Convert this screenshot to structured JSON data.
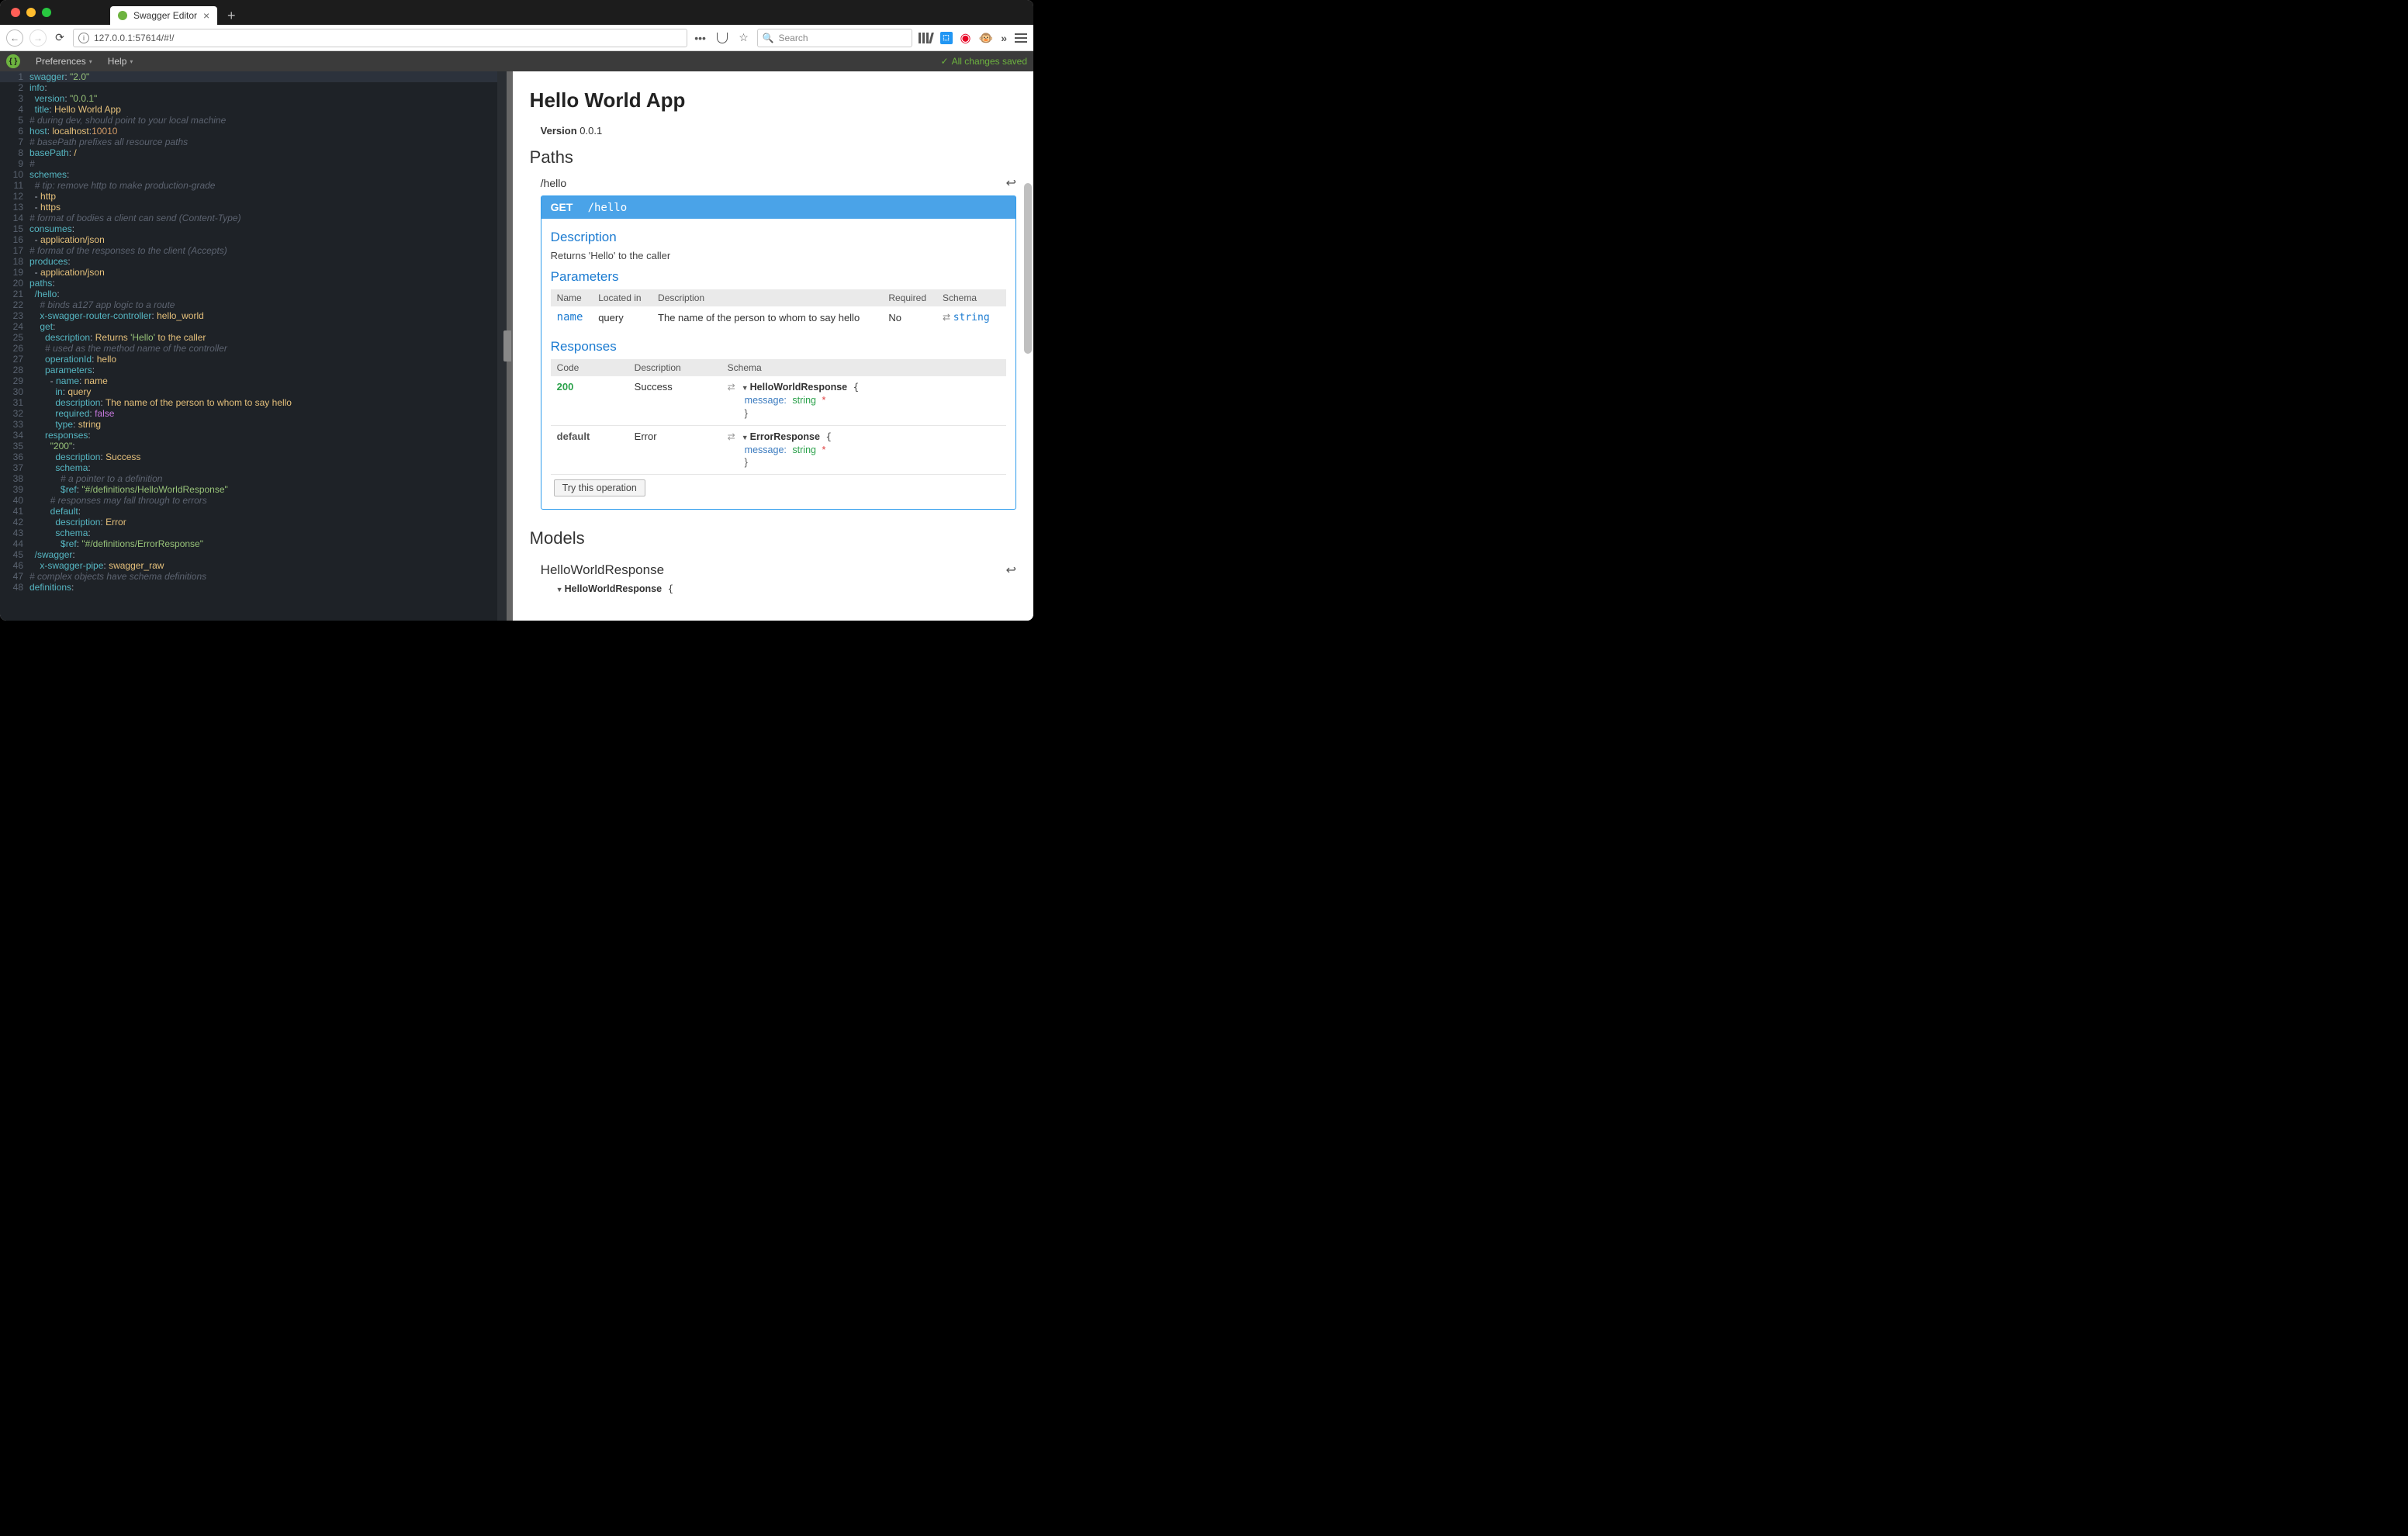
{
  "browser": {
    "tab_title": "Swagger Editor",
    "url": "127.0.0.1:57614/#!/",
    "search_placeholder": "Search"
  },
  "menubar": {
    "preferences": "Preferences",
    "help": "Help",
    "saved": "All changes saved"
  },
  "editor_lines": [
    {
      "n": 1,
      "html": "<span class='tk-key'>swagger</span><span class='tk-punc'>:</span> <span class='tk-str'>\"2.0\"</span>",
      "active": true
    },
    {
      "n": 2,
      "html": "<span class='tk-key'>info</span><span class='tk-punc'>:</span>"
    },
    {
      "n": 3,
      "html": "  <span class='tk-key'>version</span><span class='tk-punc'>:</span> <span class='tk-str'>\"0.0.1\"</span>"
    },
    {
      "n": 4,
      "html": "  <span class='tk-key'>title</span><span class='tk-punc'>:</span> <span class='tk-str2'>Hello World App</span>"
    },
    {
      "n": 5,
      "html": "<span class='tk-cmt'># during dev, should point to your local machine</span>"
    },
    {
      "n": 6,
      "html": "<span class='tk-key'>host</span><span class='tk-punc'>:</span> <span class='tk-str2'>localhost</span><span class='tk-punc'>:</span><span class='tk-num'>10010</span>"
    },
    {
      "n": 7,
      "html": "<span class='tk-cmt'># basePath prefixes all resource paths</span>"
    },
    {
      "n": 8,
      "html": "<span class='tk-key'>basePath</span><span class='tk-punc'>:</span> <span class='tk-str2'>/</span>"
    },
    {
      "n": 9,
      "html": "<span class='tk-cmt'>#</span>"
    },
    {
      "n": 10,
      "html": "<span class='tk-key'>schemes</span><span class='tk-punc'>:</span>"
    },
    {
      "n": 11,
      "html": "  <span class='tk-cmt'># tip: remove http to make production-grade</span>"
    },
    {
      "n": 12,
      "html": "  <span class='tk-punc'>-</span> <span class='tk-str2'>http</span>"
    },
    {
      "n": 13,
      "html": "  <span class='tk-punc'>-</span> <span class='tk-str2'>https</span>"
    },
    {
      "n": 14,
      "html": "<span class='tk-cmt'># format of bodies a client can send (Content-Type)</span>"
    },
    {
      "n": 15,
      "html": "<span class='tk-key'>consumes</span><span class='tk-punc'>:</span>"
    },
    {
      "n": 16,
      "html": "  <span class='tk-punc'>-</span> <span class='tk-str2'>application/json</span>"
    },
    {
      "n": 17,
      "html": "<span class='tk-cmt'># format of the responses to the client (Accepts)</span>"
    },
    {
      "n": 18,
      "html": "<span class='tk-key'>produces</span><span class='tk-punc'>:</span>"
    },
    {
      "n": 19,
      "html": "  <span class='tk-punc'>-</span> <span class='tk-str2'>application/json</span>"
    },
    {
      "n": 20,
      "html": "<span class='tk-key'>paths</span><span class='tk-punc'>:</span>"
    },
    {
      "n": 21,
      "html": "  <span class='tk-key'>/hello</span><span class='tk-punc'>:</span>"
    },
    {
      "n": 22,
      "html": "    <span class='tk-cmt'># binds a127 app logic to a route</span>"
    },
    {
      "n": 23,
      "html": "    <span class='tk-key'>x-swagger-router-controller</span><span class='tk-punc'>:</span> <span class='tk-str2'>hello_world</span>"
    },
    {
      "n": 24,
      "html": "    <span class='tk-key'>get</span><span class='tk-punc'>:</span>"
    },
    {
      "n": 25,
      "html": "      <span class='tk-key'>description</span><span class='tk-punc'>:</span> <span class='tk-str2'>Returns </span><span class='tk-str'>'Hello'</span><span class='tk-str2'> to the caller</span>"
    },
    {
      "n": 26,
      "html": "      <span class='tk-cmt'># used as the method name of the controller</span>"
    },
    {
      "n": 27,
      "html": "      <span class='tk-key'>operationId</span><span class='tk-punc'>:</span> <span class='tk-str2'>hello</span>"
    },
    {
      "n": 28,
      "html": "      <span class='tk-key'>parameters</span><span class='tk-punc'>:</span>"
    },
    {
      "n": 29,
      "html": "        <span class='tk-punc'>-</span> <span class='tk-key'>name</span><span class='tk-punc'>:</span> <span class='tk-str2'>name</span>"
    },
    {
      "n": 30,
      "html": "          <span class='tk-key'>in</span><span class='tk-punc'>:</span> <span class='tk-str2'>query</span>"
    },
    {
      "n": 31,
      "html": "          <span class='tk-key'>description</span><span class='tk-punc'>:</span> <span class='tk-str2'>The name of the person to whom to say hello</span>"
    },
    {
      "n": 32,
      "html": "          <span class='tk-key'>required</span><span class='tk-punc'>:</span> <span class='tk-bool'>false</span>"
    },
    {
      "n": 33,
      "html": "          <span class='tk-key'>type</span><span class='tk-punc'>:</span> <span class='tk-str2'>string</span>"
    },
    {
      "n": 34,
      "html": "      <span class='tk-key'>responses</span><span class='tk-punc'>:</span>"
    },
    {
      "n": 35,
      "html": "        <span class='tk-str'>\"200\"</span><span class='tk-punc'>:</span>"
    },
    {
      "n": 36,
      "html": "          <span class='tk-key'>description</span><span class='tk-punc'>:</span> <span class='tk-str2'>Success</span>"
    },
    {
      "n": 37,
      "html": "          <span class='tk-key'>schema</span><span class='tk-punc'>:</span>"
    },
    {
      "n": 38,
      "html": "            <span class='tk-cmt'># a pointer to a definition</span>"
    },
    {
      "n": 39,
      "html": "            <span class='tk-key'>$ref</span><span class='tk-punc'>:</span> <span class='tk-str'>\"#/definitions/HelloWorldResponse\"</span>"
    },
    {
      "n": 40,
      "html": "        <span class='tk-cmt'># responses may fall through to errors</span>"
    },
    {
      "n": 41,
      "html": "        <span class='tk-key'>default</span><span class='tk-punc'>:</span>"
    },
    {
      "n": 42,
      "html": "          <span class='tk-key'>description</span><span class='tk-punc'>:</span> <span class='tk-str2'>Error</span>"
    },
    {
      "n": 43,
      "html": "          <span class='tk-key'>schema</span><span class='tk-punc'>:</span>"
    },
    {
      "n": 44,
      "html": "            <span class='tk-key'>$ref</span><span class='tk-punc'>:</span> <span class='tk-str'>\"#/definitions/ErrorResponse\"</span>"
    },
    {
      "n": 45,
      "html": "  <span class='tk-key'>/swagger</span><span class='tk-punc'>:</span>"
    },
    {
      "n": 46,
      "html": "    <span class='tk-key'>x-swagger-pipe</span><span class='tk-punc'>:</span> <span class='tk-str2'>swagger_raw</span>"
    },
    {
      "n": 47,
      "html": "<span class='tk-cmt'># complex objects have schema definitions</span>"
    },
    {
      "n": 48,
      "html": "<span class='tk-key'>definitions</span><span class='tk-punc'>:</span>"
    }
  ],
  "preview": {
    "title": "Hello World App",
    "version_label": "Version",
    "version": "0.0.1",
    "paths_heading": "Paths",
    "path": "/hello",
    "op": {
      "verb": "GET",
      "path": "/hello",
      "description_heading": "Description",
      "description": "Returns 'Hello' to the caller",
      "parameters_heading": "Parameters",
      "param_headers": {
        "name": "Name",
        "located": "Located in",
        "desc": "Description",
        "req": "Required",
        "schema": "Schema"
      },
      "params": [
        {
          "name": "name",
          "in": "query",
          "desc": "The name of the person to whom to say hello",
          "req": "No",
          "type": "string"
        }
      ],
      "responses_heading": "Responses",
      "resp_headers": {
        "code": "Code",
        "desc": "Description",
        "schema": "Schema"
      },
      "responses": [
        {
          "code": "200",
          "code_class": "code200",
          "desc": "Success",
          "schema_name": "HelloWorldResponse",
          "prop": "message",
          "type": "string"
        },
        {
          "code": "default",
          "code_class": "codedef",
          "desc": "Error",
          "schema_name": "ErrorResponse",
          "prop": "message",
          "type": "string"
        }
      ],
      "try_label": "Try this operation"
    },
    "models_heading": "Models",
    "model": {
      "name": "HelloWorldResponse",
      "schema_name": "HelloWorldResponse"
    }
  }
}
